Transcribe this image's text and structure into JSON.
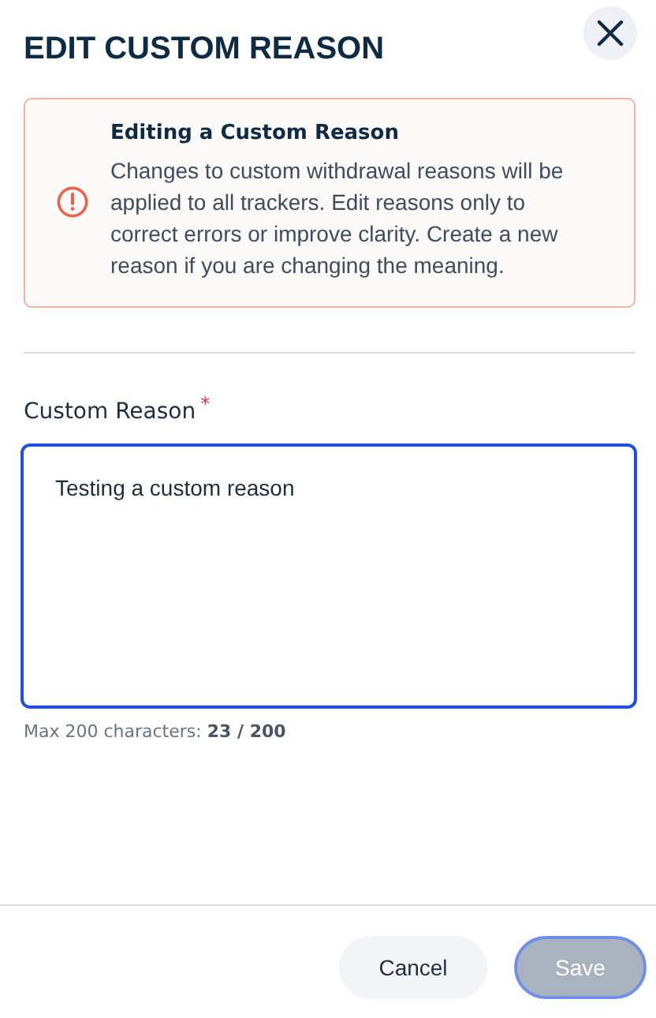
{
  "title": "EDIT CUSTOM REASON",
  "alert": {
    "title": "Editing a Custom Reason",
    "body": "Changes to custom withdrawal reasons will be applied to all trackers. Edit reasons only to correct errors or improve clarity. Create a new reason if you are changing the meaning."
  },
  "field": {
    "label": "Custom Reason",
    "required_mark": "*",
    "value": "Testing a custom reason",
    "focused": true,
    "counter": "Max 200 characters: **23 / 200**"
  },
  "buttons": [
    {
      "label": "Cancel",
      "kind": "secondary",
      "disabled": false
    },
    {
      "label": "Save",
      "kind": "primary",
      "disabled": true
    }
  ]
}
